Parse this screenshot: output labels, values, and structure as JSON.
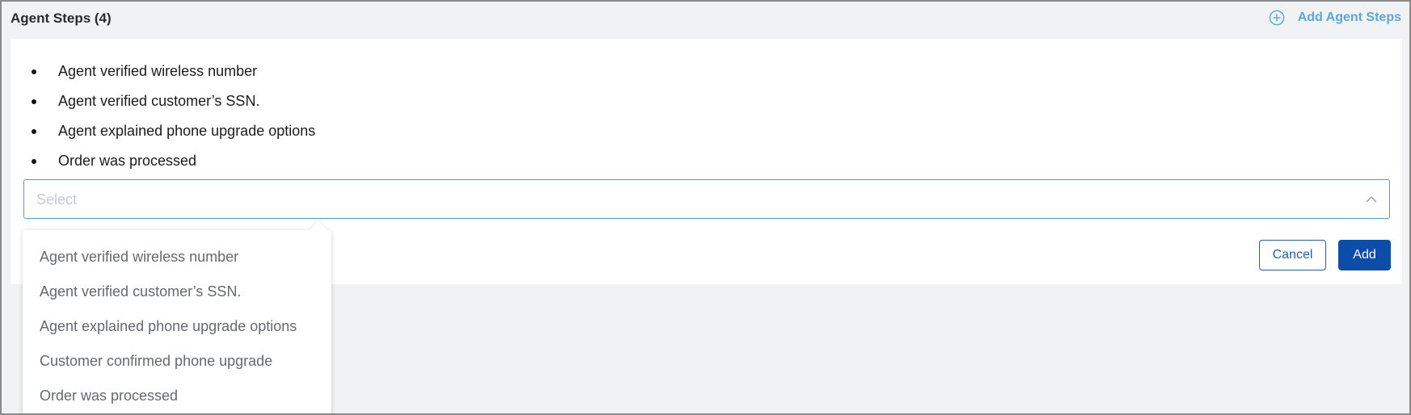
{
  "header": {
    "title": "Agent Steps (4)",
    "add_label": "Add Agent Steps",
    "add_icon": "plus-circle-icon",
    "accent_color": "#5aa6e0"
  },
  "steps": [
    {
      "label": "Agent verified wireless number"
    },
    {
      "label": "Agent verified customer’s SSN."
    },
    {
      "label": "Agent explained phone upgrade options"
    },
    {
      "label": "Order was processed"
    }
  ],
  "select": {
    "placeholder": "Select",
    "icon": "chevron-up-icon",
    "border_color": "#4a9fd8"
  },
  "actions": {
    "cancel_label": "Cancel",
    "add_label": "Add",
    "primary_color": "#0b4da8"
  },
  "dropdown": {
    "options": [
      {
        "label": "Agent verified wireless number"
      },
      {
        "label": "Agent verified customer’s SSN."
      },
      {
        "label": "Agent explained phone upgrade options"
      },
      {
        "label": "Customer confirmed phone upgrade"
      },
      {
        "label": "Order was processed"
      }
    ]
  }
}
